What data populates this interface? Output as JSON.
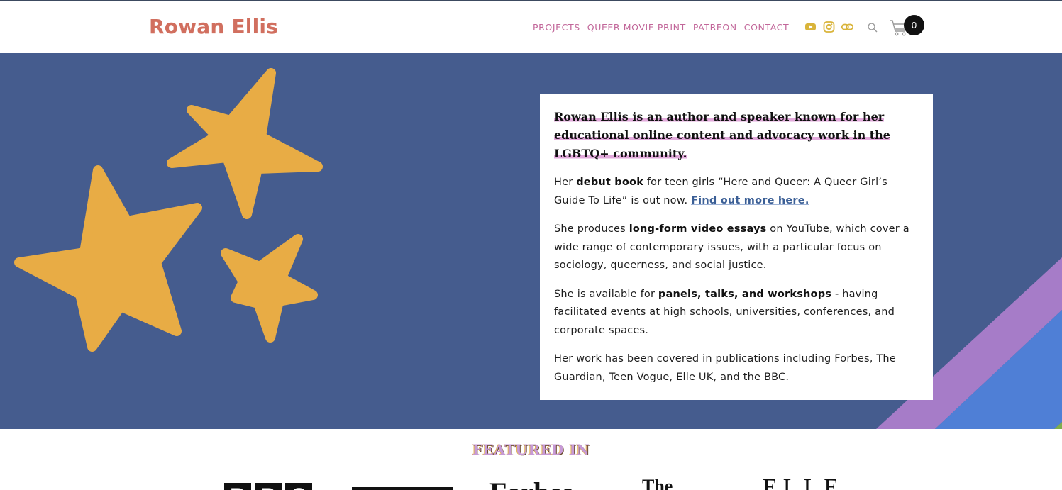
{
  "header": {
    "brand": "Rowan Ellis",
    "nav": [
      "PROJECTS",
      "QUEER MOVIE PRINT",
      "PATREON",
      "CONTACT"
    ],
    "social_icons": [
      "youtube-icon",
      "instagram-icon",
      "link-icon"
    ],
    "cart_count": "0"
  },
  "bio": {
    "lead": "Rowan Ellis is an author and speaker known for her educational online content and advocacy work in the LGBTQ+ community.",
    "p1_a": "Her ",
    "p1_b": "debut book",
    "p1_c": " for teen girls “Here and Queer: A Queer Girl’s Guide To Life” is out now. ",
    "p1_link": "Find out more here.",
    "p2_a": "She produces ",
    "p2_b": "long-form video essays",
    "p2_c": " on YouTube, which cover a wide range of contemporary issues, with a particular focus on sociology, queerness, and social justice.",
    "p3_a": "She is available for ",
    "p3_b": "panels, talks, and workshops",
    "p3_c": " - having facilitated events at high schools, universities, conferences, and corporate spaces.",
    "p4": "Her work has been covered in publications including Forbes, The Guardian, Teen Vogue, Elle UK, and the BBC."
  },
  "featured": {
    "title": "FEATURED IN",
    "logos": {
      "bbc": [
        "B",
        "B",
        "C"
      ],
      "forbes": "Forbes",
      "guardian": "The",
      "elle": "ELLE"
    }
  },
  "colors": {
    "brand": "#d16f5f",
    "nav": "#c2679a",
    "hero_bg": "#455c8e",
    "star": "#e8ac45",
    "stripe_purple": "#a67cc8",
    "stripe_blue": "#4f7fd6",
    "highlight": "#e2a9db"
  }
}
